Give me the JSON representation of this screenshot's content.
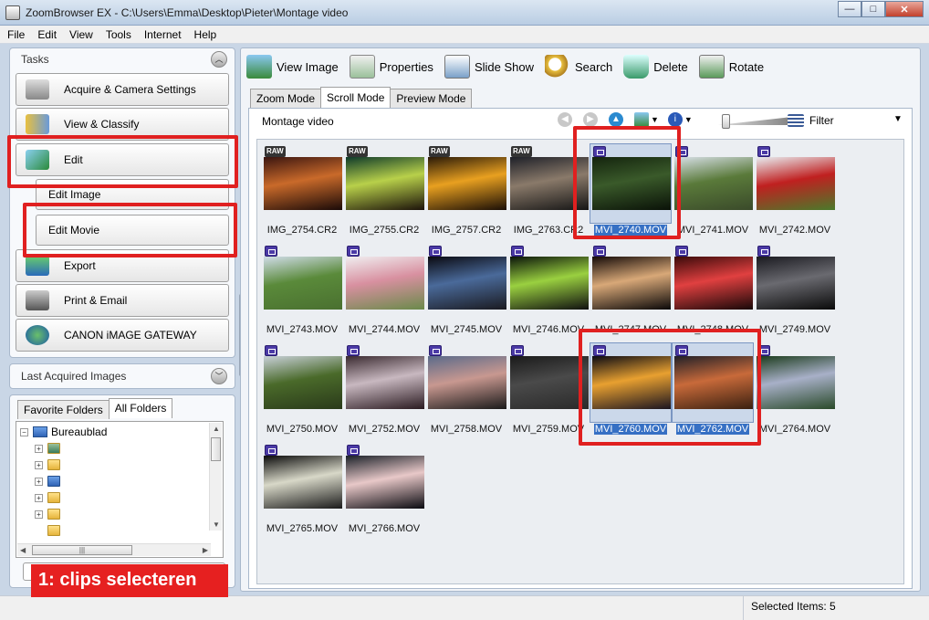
{
  "window": {
    "title": "ZoomBrowser EX - C:\\Users\\Emma\\Desktop\\Pieter\\Montage video",
    "minimize": "—",
    "maximize": "□",
    "close": "✕"
  },
  "menu": [
    "File",
    "Edit",
    "View",
    "Tools",
    "Internet",
    "Help"
  ],
  "tasks": {
    "heading": "Tasks",
    "buttons": {
      "acquire": "Acquire & Camera Settings",
      "view": "View & Classify",
      "edit": "Edit",
      "edit_image": "Edit Image",
      "edit_movie": "Edit Movie",
      "export": "Export",
      "print": "Print & Email",
      "canon": "CANON iMAGE GATEWAY"
    }
  },
  "last_acquired": {
    "heading": "Last Acquired Images"
  },
  "folders": {
    "tab_favorite": "Favorite Folders",
    "tab_all": "All Folders",
    "root": "Bureaublad"
  },
  "toolbar": {
    "view_image": "View Image",
    "properties": "Properties",
    "slide_show": "Slide Show",
    "search": "Search",
    "delete": "Delete",
    "rotate": "Rotate"
  },
  "view_tabs": [
    "Zoom Mode",
    "Scroll Mode",
    "Preview Mode"
  ],
  "folder_name": "Montage video",
  "filter_label": "Filter",
  "thumbnails": [
    {
      "name": "IMG_2754.CR2",
      "type": "RAW",
      "selected": false,
      "colors": [
        "#3a1510",
        "#c96a2a",
        "#1a0a08"
      ]
    },
    {
      "name": "IMG_2755.CR2",
      "type": "RAW",
      "selected": false,
      "colors": [
        "#0e3a2a",
        "#b8d04a",
        "#1c120a"
      ]
    },
    {
      "name": "IMG_2757.CR2",
      "type": "RAW",
      "selected": false,
      "colors": [
        "#2a1a08",
        "#e8a020",
        "#1a0e06"
      ]
    },
    {
      "name": "IMG_2763.CR2",
      "type": "RAW",
      "selected": false,
      "colors": [
        "#1e2028",
        "#8a7a6a",
        "#151515"
      ]
    },
    {
      "name": "MVI_2740.MOV",
      "type": "MOV",
      "selected": true,
      "colors": [
        "#14240e",
        "#3a5a2a",
        "#0a1208"
      ]
    },
    {
      "name": "MVI_2741.MOV",
      "type": "MOV",
      "selected": false,
      "colors": [
        "#d8e0e8",
        "#5a7a3a",
        "#3a4a2a"
      ]
    },
    {
      "name": "MVI_2742.MOV",
      "type": "MOV",
      "selected": false,
      "colors": [
        "#e8eef2",
        "#c02020",
        "#4a7a2a"
      ]
    },
    {
      "name": "MVI_2743.MOV",
      "type": "MOV",
      "selected": false,
      "colors": [
        "#d0dce8",
        "#5a8a3a",
        "#4a7030"
      ]
    },
    {
      "name": "MVI_2744.MOV",
      "type": "MOV",
      "selected": false,
      "colors": [
        "#f0eef0",
        "#d890a0",
        "#6a8a4a"
      ]
    },
    {
      "name": "MVI_2745.MOV",
      "type": "MOV",
      "selected": false,
      "colors": [
        "#0a0a10",
        "#4a6a9a",
        "#1a1a20"
      ]
    },
    {
      "name": "MVI_2746.MOV",
      "type": "MOV",
      "selected": false,
      "colors": [
        "#0a140a",
        "#9ad040",
        "#101010"
      ]
    },
    {
      "name": "MVI_2747.MOV",
      "type": "MOV",
      "selected": false,
      "colors": [
        "#140a08",
        "#d8a878",
        "#0a0808"
      ]
    },
    {
      "name": "MVI_2748.MOV",
      "type": "MOV",
      "selected": false,
      "colors": [
        "#3a0a0a",
        "#e04040",
        "#180808"
      ]
    },
    {
      "name": "MVI_2749.MOV",
      "type": "MOV",
      "selected": false,
      "colors": [
        "#1a1a20",
        "#6a6a70",
        "#0a0a0a"
      ]
    },
    {
      "name": "MVI_2750.MOV",
      "type": "MOV",
      "selected": false,
      "colors": [
        "#c8d0d8",
        "#4a6a2a",
        "#2a3a1a"
      ]
    },
    {
      "name": "MVI_2752.MOV",
      "type": "MOV",
      "selected": false,
      "colors": [
        "#3a2a30",
        "#c8b8c0",
        "#2a1a20"
      ]
    },
    {
      "name": "MVI_2758.MOV",
      "type": "MOV",
      "selected": false,
      "colors": [
        "#5a6a8a",
        "#c89890",
        "#1a1a1a"
      ]
    },
    {
      "name": "MVI_2759.MOV",
      "type": "MOV",
      "selected": false,
      "colors": [
        "#1a1a1a",
        "#4a4a4a",
        "#2a2a2a"
      ]
    },
    {
      "name": "MVI_2760.MOV",
      "type": "MOV",
      "selected": true,
      "colors": [
        "#0a0a14",
        "#e8a030",
        "#1a1420"
      ]
    },
    {
      "name": "MVI_2762.MOV",
      "type": "MOV",
      "selected": true,
      "colors": [
        "#202028",
        "#c86a3a",
        "#3a2010"
      ]
    },
    {
      "name": "MVI_2764.MOV",
      "type": "MOV",
      "selected": false,
      "colors": [
        "#1a3a1a",
        "#a8b0c8",
        "#2a4a2a"
      ]
    },
    {
      "name": "MVI_2765.MOV",
      "type": "MOV",
      "selected": false,
      "colors": [
        "#0a0a0a",
        "#d8d8c8",
        "#1a1a1a"
      ]
    },
    {
      "name": "MVI_2766.MOV",
      "type": "MOV",
      "selected": false,
      "colors": [
        "#1a2028",
        "#e8c8c8",
        "#0a0a10"
      ]
    }
  ],
  "status": {
    "selected_items": "Selected Items: 5"
  },
  "annotation": {
    "callout": "1: clips selecteren"
  }
}
